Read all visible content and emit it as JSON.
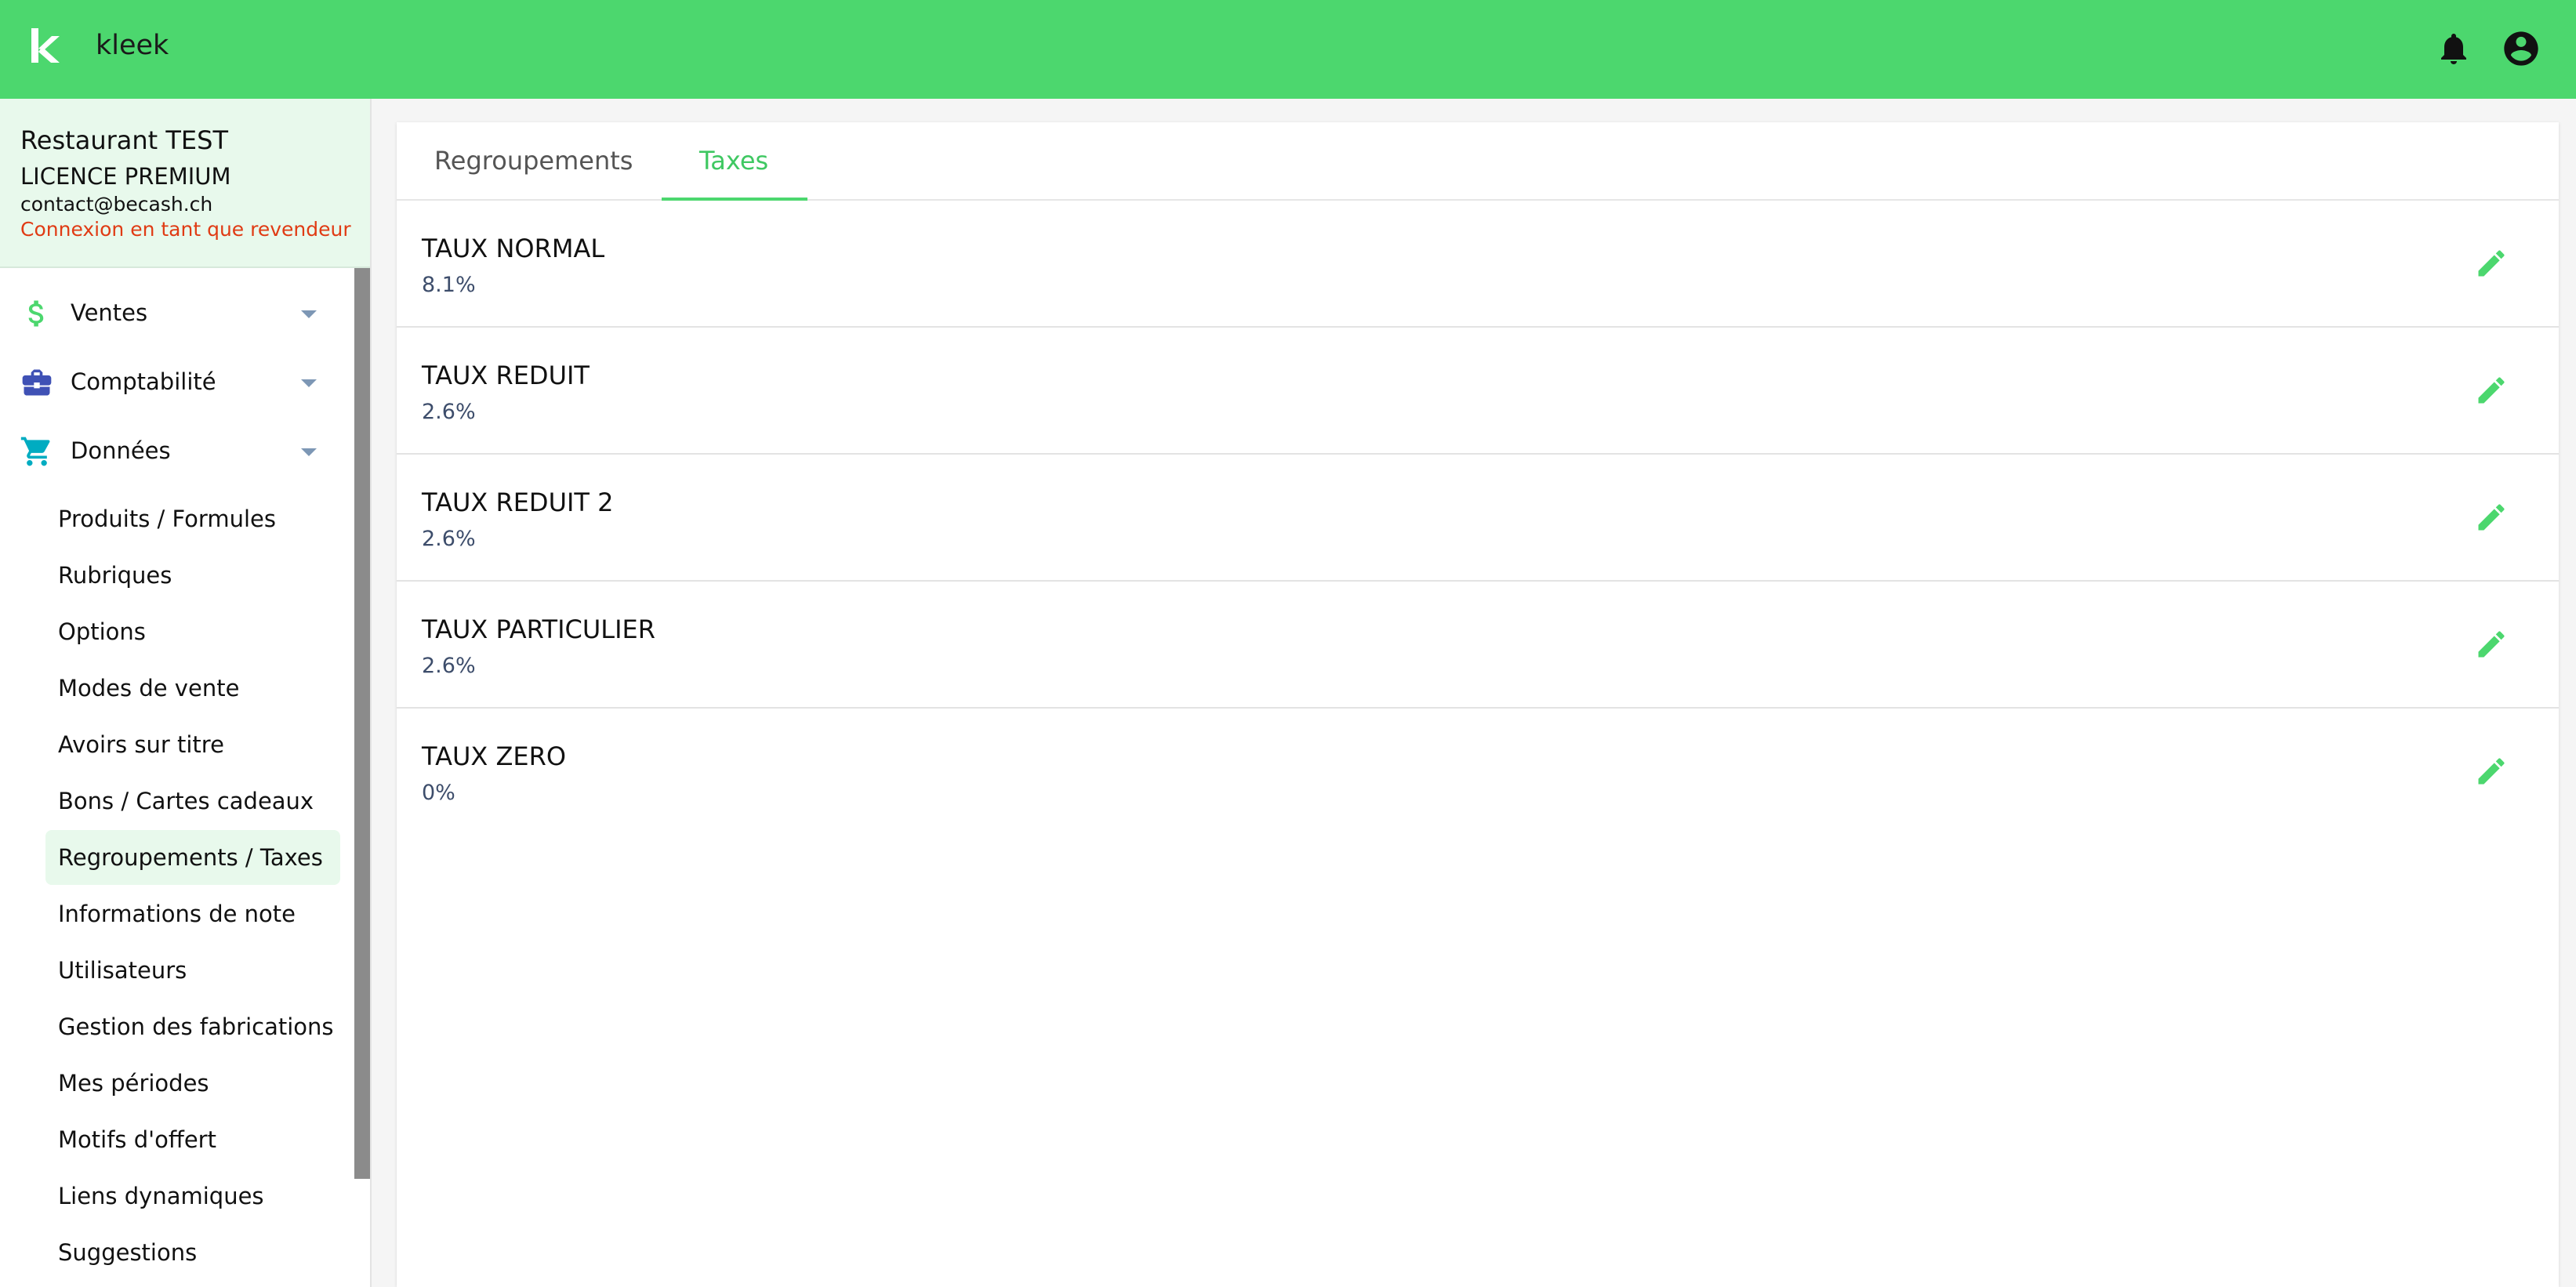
{
  "app": {
    "name": "kleek",
    "accent": "#4cd76e"
  },
  "topbar": {
    "icons": [
      "notifications-icon",
      "account-circle-icon"
    ]
  },
  "account": {
    "restaurant": "Restaurant TEST",
    "licence": "LICENCE PREMIUM",
    "email": "contact@becash.ch",
    "reseller_link": "Connexion en tant que revendeur"
  },
  "sidebar": {
    "sections": [
      {
        "label": "Ventes",
        "icon": "dollar-icon"
      },
      {
        "label": "Comptabilité",
        "icon": "briefcase-icon"
      },
      {
        "label": "Données",
        "icon": "cart-icon"
      }
    ],
    "items": [
      {
        "label": "Produits / Formules"
      },
      {
        "label": "Rubriques"
      },
      {
        "label": "Options"
      },
      {
        "label": "Modes de vente"
      },
      {
        "label": "Avoirs sur titre"
      },
      {
        "label": "Bons / Cartes cadeaux"
      },
      {
        "label": "Regroupements / Taxes",
        "active": true
      },
      {
        "label": "Informations de note"
      },
      {
        "label": "Utilisateurs"
      },
      {
        "label": "Gestion des fabrications"
      },
      {
        "label": "Mes périodes"
      },
      {
        "label": "Motifs d'offert"
      },
      {
        "label": "Liens dynamiques"
      },
      {
        "label": "Suggestions"
      }
    ]
  },
  "tabs": [
    {
      "label": "Regroupements"
    },
    {
      "label": "Taxes",
      "active": true
    }
  ],
  "taxes": [
    {
      "name": "TAUX NORMAL",
      "rate": "8.1%"
    },
    {
      "name": "TAUX REDUIT",
      "rate": "2.6%"
    },
    {
      "name": "TAUX REDUIT 2",
      "rate": "2.6%"
    },
    {
      "name": "TAUX PARTICULIER",
      "rate": "2.6%"
    },
    {
      "name": "TAUX ZERO",
      "rate": "0%"
    }
  ]
}
